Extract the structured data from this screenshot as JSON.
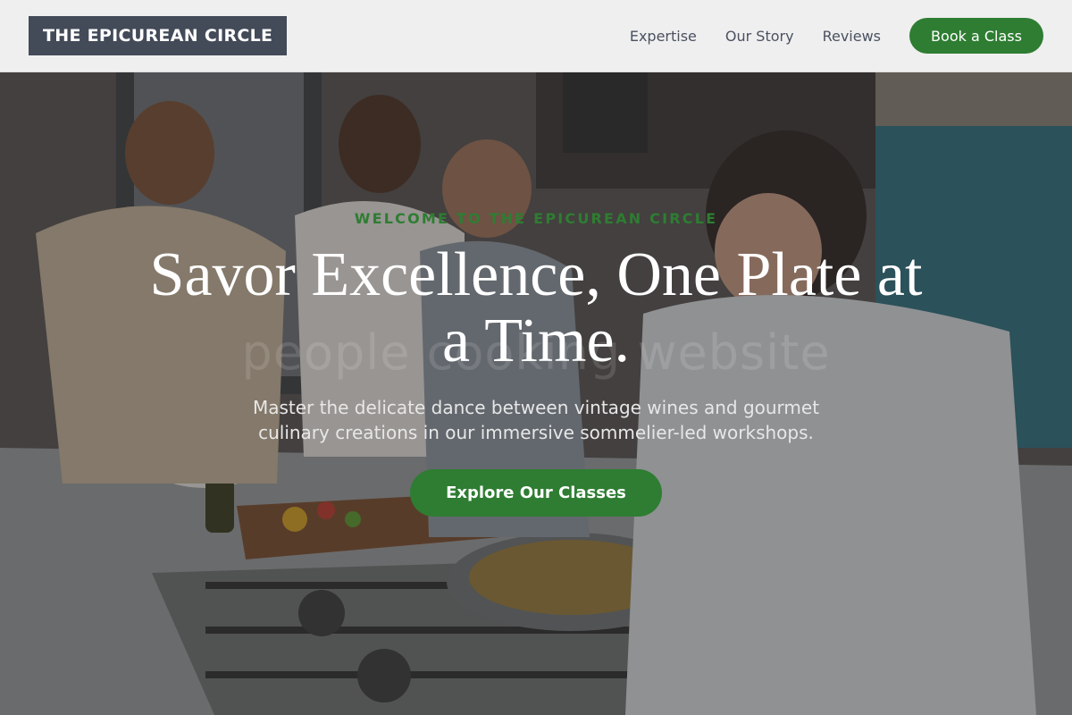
{
  "header": {
    "logo_text": "THE EPICUREAN CIRCLE",
    "nav": [
      {
        "label": "Expertise"
      },
      {
        "label": "Our Story"
      },
      {
        "label": "Reviews"
      }
    ],
    "cta_label": "Book a Class"
  },
  "hero": {
    "eyebrow": "WELCOME TO THE EPICUREAN CIRCLE",
    "headline": "Savor Excellence, One Plate at a Time.",
    "subtext": "Master the delicate dance between vintage wines and gourmet culinary creations in our immersive sommelier-led workshops.",
    "cta_label": "Explore Our Classes",
    "watermark": "people cooking website"
  },
  "colors": {
    "brand_green": "#2e7d32",
    "logo_bg": "#434a58",
    "header_bg": "#efefef"
  }
}
